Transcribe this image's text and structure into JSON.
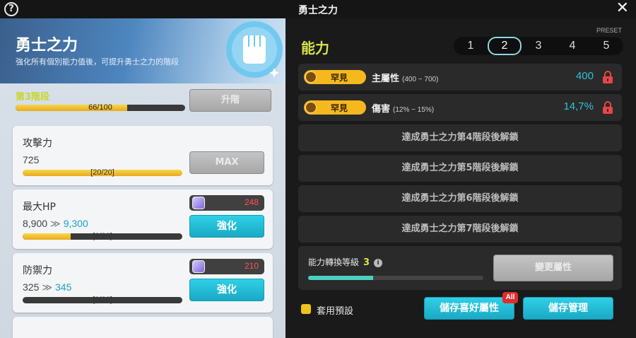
{
  "window": {
    "title": "勇士之力",
    "help": "?",
    "close": "✕"
  },
  "hero": {
    "title": "勇士之力",
    "subtitle": "強化所有個別能力值後，可提升勇士之力的階段"
  },
  "stage": {
    "label": "第3階段",
    "progress_text": "66/100",
    "progress": 0.66,
    "upgrade_label": "升階"
  },
  "cards": [
    {
      "name": "攻擊力",
      "value": "725",
      "next": "",
      "progress_text": "[20/20]",
      "progress": 1.0,
      "button": "MAX",
      "cost": ""
    },
    {
      "name": "最大HP",
      "value": "8,900",
      "next": "9,300",
      "progress_text": "[6/20]",
      "progress": 0.3,
      "button": "強化",
      "cost": "248"
    },
    {
      "name": "防禦力",
      "value": "325",
      "next": "345",
      "progress_text": "[0/20]",
      "progress": 0.0,
      "button": "強化",
      "cost": "210"
    }
  ],
  "ability": {
    "title": "能力",
    "preset_label": "PRESET",
    "presets": [
      "1",
      "2",
      "3",
      "4",
      "5"
    ],
    "active_preset": "2",
    "stats": [
      {
        "rarity": "罕見",
        "name": "主屬性",
        "range": "(400 ~ 700)",
        "value": "400"
      },
      {
        "rarity": "罕見",
        "name": "傷害",
        "range": "(12% ~ 15%)",
        "value": "14,7%"
      }
    ],
    "locked": [
      "達成勇士之力第4階段後解鎖",
      "達成勇士之力第5階段後解鎖",
      "達成勇士之力第6階段後解鎖",
      "達成勇士之力第7階段後解鎖"
    ],
    "convert_label": "能力轉換等級",
    "convert_level": "3",
    "convert_progress": 0.37,
    "change_button": "變更屬性",
    "apply_preset_label": "套用預設",
    "save_favorite_button": "儲存喜好屬性",
    "all_badge": "All",
    "save_manage_button": "儲存管理"
  },
  "colors": {
    "accent_yellow": "#d8e24a",
    "teal": "#1aa9c4",
    "rarity": "#f5b91e",
    "lock_red": "#e84545"
  }
}
